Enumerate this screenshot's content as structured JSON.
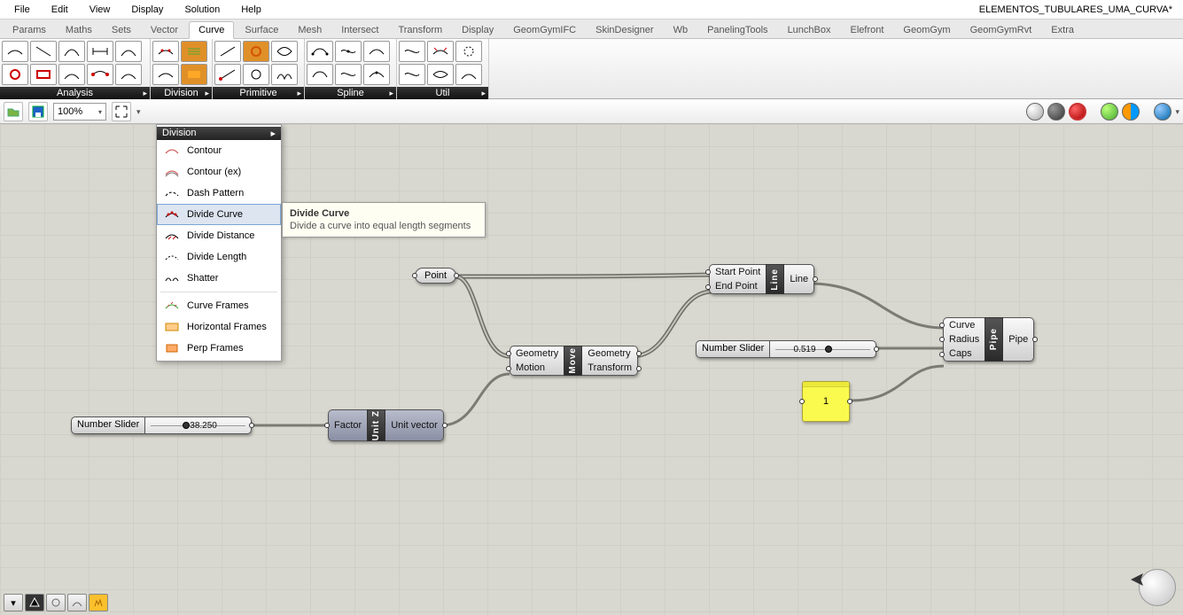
{
  "window_title": "ELEMENTOS_TUBULARES_UMA_CURVA*",
  "menu": [
    "File",
    "Edit",
    "View",
    "Display",
    "Solution",
    "Help"
  ],
  "tabs": [
    "Params",
    "Maths",
    "Sets",
    "Vector",
    "Curve",
    "Surface",
    "Mesh",
    "Intersect",
    "Transform",
    "Display",
    "GeomGymIFC",
    "SkinDesigner",
    "Wb",
    "PanelingTools",
    "LunchBox",
    "Elefront",
    "GeomGym",
    "GeomGymRvt",
    "Extra"
  ],
  "active_tab": "Curve",
  "ribbon_groups": [
    "Analysis",
    "Division",
    "Primitive",
    "Spline",
    "Util"
  ],
  "zoom": "100%",
  "dropdown": {
    "caption": "Division",
    "items": [
      "Contour",
      "Contour (ex)",
      "Dash Pattern",
      "Divide Curve",
      "Divide Distance",
      "Divide Length",
      "Shatter"
    ],
    "items2": [
      "Curve Frames",
      "Horizontal Frames",
      "Perp Frames"
    ],
    "selected": "Divide Curve"
  },
  "tooltip": {
    "title": "Divide Curve",
    "desc": "Divide a curve into equal length segments"
  },
  "nodes": {
    "point": "Point",
    "move": {
      "core": "Move",
      "in": [
        "Geometry",
        "Motion"
      ],
      "out": [
        "Geometry",
        "Transform"
      ]
    },
    "line": {
      "core": "Line",
      "in": [
        "Start Point",
        "End Point"
      ],
      "out": [
        "Line"
      ]
    },
    "unitz": {
      "core": "Unit Z",
      "in": [
        "Factor"
      ],
      "out": [
        "Unit vector"
      ]
    },
    "pipe": {
      "core": "Pipe",
      "in": [
        "Curve",
        "Radius",
        "Caps"
      ],
      "out": [
        "Pipe"
      ]
    },
    "slider1": {
      "label": "Number Slider",
      "value": "38.250",
      "knob_pct": 38
    },
    "slider2": {
      "label": "Number Slider",
      "value": "0.519",
      "knob_pct": 52
    },
    "panel_value": "1"
  }
}
